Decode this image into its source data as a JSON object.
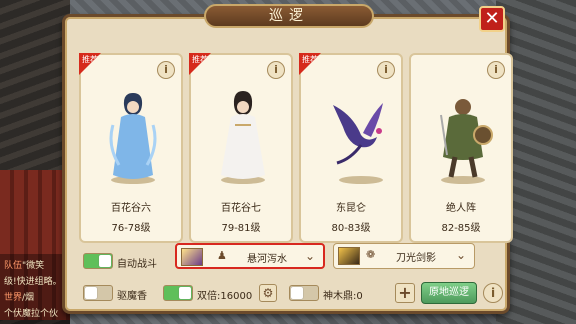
{
  "window": {
    "title": "巡逻",
    "close_label": "✕"
  },
  "cards": [
    {
      "badge": "推荐",
      "name": "百花谷六",
      "level": "76-78级"
    },
    {
      "badge": "推荐",
      "name": "百花谷七",
      "level": "79-81级"
    },
    {
      "badge": "推荐",
      "name": "东昆仑",
      "level": "80-83级"
    },
    {
      "badge": "",
      "name": "绝人阵",
      "level": "82-85级"
    }
  ],
  "info_label": "i",
  "options": {
    "auto_battle": {
      "label": "自动战斗",
      "on": true
    },
    "skill_select_1": {
      "label": "悬河泻水",
      "icon": "person-icon"
    },
    "skill_select_2": {
      "label": "刀光剑影",
      "icon": "paw-icon"
    },
    "demon_incense": {
      "label": "驱魔香",
      "on": false
    },
    "double": {
      "label": "双倍:16000",
      "on": true
    },
    "divine_wood": {
      "label": "神木鼎:0",
      "on": false
    },
    "patrol_button": {
      "label": "原地巡逻"
    }
  },
  "chat": {
    "lines": [
      {
        "tag": "队伍",
        "text": "\"微笑"
      },
      {
        "tag": "",
        "text": "级!快进组略。"
      },
      {
        "tag": "世界",
        "text": "/烟"
      },
      {
        "tag": "",
        "text": "个伏魔拉个伙"
      }
    ]
  },
  "colors": {
    "accent_red": "#d8281f",
    "toggle_on": "#5fbf5a",
    "panel_bg": "#e9dcc1"
  }
}
